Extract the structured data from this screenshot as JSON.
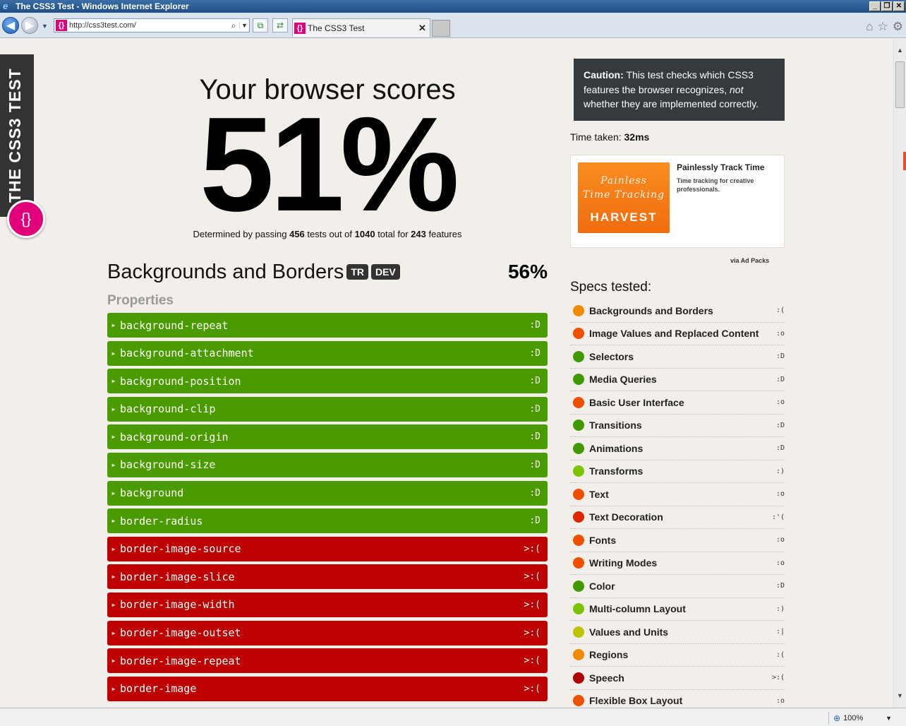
{
  "window": {
    "title": "The CSS3 Test - Windows Internet Explorer",
    "buttons": [
      "_",
      "❐",
      "✕"
    ]
  },
  "browser": {
    "url": "http://css3test.com/",
    "tab_title": "The CSS3 Test",
    "tab_close": "✕",
    "zoom": "100%"
  },
  "site": {
    "ribbon": "THE CSS3 TEST",
    "badge_glyph": "{}"
  },
  "score": {
    "heading": "Your browser scores",
    "percent": "51%",
    "passing_prefix": "Determined by passing",
    "passed": "456",
    "passing_mid": "tests out of",
    "total": "1040",
    "passing_mid2": "total for",
    "features": "243",
    "passing_suffix": "features"
  },
  "caution": {
    "label": "Caution:",
    "text1": "This test checks which CSS3 features the browser recognizes,",
    "not": "not",
    "text2": "whether they are implemented correctly."
  },
  "time": {
    "label": "Time taken:",
    "value": "32ms"
  },
  "ad": {
    "logo_line1": "Painless",
    "logo_line2": "Time Tracking",
    "logo_brand": "HARVEST",
    "title": "Painlessly Track Time",
    "text": "Time tracking for creative professionals.",
    "via": "via Ad Packs"
  },
  "section": {
    "title": "Backgrounds and Borders",
    "badges": [
      "TR",
      "DEV"
    ],
    "percent": "56%",
    "subhead": "Properties",
    "properties": [
      {
        "name": "background-repeat",
        "status": "pass",
        "face": ":D"
      },
      {
        "name": "background-attachment",
        "status": "pass",
        "face": ":D"
      },
      {
        "name": "background-position",
        "status": "pass",
        "face": ":D"
      },
      {
        "name": "background-clip",
        "status": "pass",
        "face": ":D"
      },
      {
        "name": "background-origin",
        "status": "pass",
        "face": ":D"
      },
      {
        "name": "background-size",
        "status": "pass",
        "face": ":D"
      },
      {
        "name": "background",
        "status": "pass",
        "face": ":D"
      },
      {
        "name": "border-radius",
        "status": "pass",
        "face": ":D"
      },
      {
        "name": "border-image-source",
        "status": "fail",
        "face": ">:("
      },
      {
        "name": "border-image-slice",
        "status": "fail",
        "face": ">:("
      },
      {
        "name": "border-image-width",
        "status": "fail",
        "face": ">:("
      },
      {
        "name": "border-image-outset",
        "status": "fail",
        "face": ">:("
      },
      {
        "name": "border-image-repeat",
        "status": "fail",
        "face": ">:("
      },
      {
        "name": "border-image",
        "status": "fail",
        "face": ">:("
      }
    ]
  },
  "specs": {
    "title": "Specs tested:",
    "items": [
      {
        "name": "Backgrounds and Borders",
        "face": ":(",
        "color": "#f08a00"
      },
      {
        "name": "Image Values and Replaced Content",
        "face": ":o",
        "color": "#ee5000"
      },
      {
        "name": "Selectors",
        "face": ":D",
        "color": "#3e9a00"
      },
      {
        "name": "Media Queries",
        "face": ":D",
        "color": "#3e9a00"
      },
      {
        "name": "Basic User Interface",
        "face": ":o",
        "color": "#ee5000"
      },
      {
        "name": "Transitions",
        "face": ":D",
        "color": "#3e9a00"
      },
      {
        "name": "Animations",
        "face": ":D",
        "color": "#3e9a00"
      },
      {
        "name": "Transforms",
        "face": ":)",
        "color": "#7cc400"
      },
      {
        "name": "Text",
        "face": ":o",
        "color": "#ee5000"
      },
      {
        "name": "Text Decoration",
        "face": ":'(",
        "color": "#e02800"
      },
      {
        "name": "Fonts",
        "face": ":o",
        "color": "#ee5000"
      },
      {
        "name": "Writing Modes",
        "face": ":o",
        "color": "#ee5000"
      },
      {
        "name": "Color",
        "face": ":D",
        "color": "#3e9a00"
      },
      {
        "name": "Multi-column Layout",
        "face": ":)",
        "color": "#7cc400"
      },
      {
        "name": "Values and Units",
        "face": ":|",
        "color": "#bcc400"
      },
      {
        "name": "Regions",
        "face": ":(",
        "color": "#f08a00"
      },
      {
        "name": "Speech",
        "face": ">:(",
        "color": "#b00000"
      },
      {
        "name": "Flexible Box Layout",
        "face": ":o",
        "color": "#ee5000"
      }
    ]
  }
}
